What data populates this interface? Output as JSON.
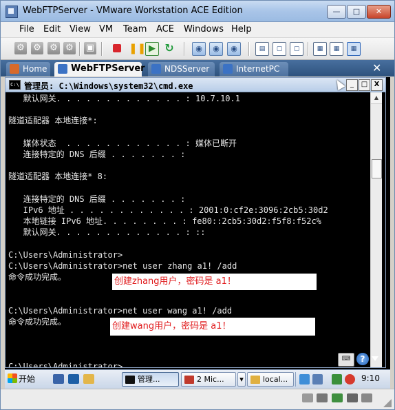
{
  "window": {
    "title": "WebFTPServer - VMware Workstation ACE Edition",
    "min_glyph": "—",
    "max_glyph": "□",
    "close_glyph": "✕"
  },
  "menu": [
    "File",
    "Edit",
    "View",
    "VM",
    "Team",
    "ACE",
    "Windows",
    "Help"
  ],
  "tabs": [
    {
      "label": "Home",
      "active": false,
      "icon_color": "#d86a2b"
    },
    {
      "label": "WebFTPServer",
      "active": true,
      "icon_color": "#3b72c4"
    },
    {
      "label": "NDSServer",
      "active": false,
      "icon_color": "#3b72c4"
    },
    {
      "label": "InternetPC",
      "active": false,
      "icon_color": "#3b72c4"
    }
  ],
  "tabs_close_glyph": "✕",
  "cmd": {
    "icon_text": "C:\\",
    "title": "管理员: C:\\Windows\\system32\\cmd.exe",
    "min_glyph": "_",
    "max_glyph": "□",
    "close_glyph": "X",
    "lines": [
      "   默认网关. . . . . . . . . . . . . : 10.7.10.1",
      "",
      "隧道适配器 本地连接*:",
      "",
      "   媒体状态  . . . . . . . . . . . . : 媒体已断开",
      "   连接特定的 DNS 后缀 . . . . . . . :",
      "",
      "隧道适配器 本地连接* 8:",
      "",
      "   连接特定的 DNS 后缀 . . . . . . . :",
      "   IPv6 地址 . . . . . . . . . . . . : 2001:0:cf2e:3096:2cb5:30d2",
      "   本地链接 IPv6 地址. . . . . . . . : fe80::2cb5:30d2:f5f8:f52c%",
      "   默认网关. . . . . . . . . . . . . : ::",
      "",
      "C:\\Users\\Administrator>",
      "C:\\Users\\Administrator>net user zhang a1! /add",
      "命令成功完成。",
      "",
      "",
      "C:\\Users\\Administrator>net user wang a1! /add",
      "命令成功完成。",
      "",
      "",
      "",
      "C:\\Users\\Administrator>_"
    ]
  },
  "annotations": {
    "zhang": "创建zhang用户，密码是 a1！",
    "wang": "创建wang用户，密码是 a1！"
  },
  "guest_taskbar": {
    "start_label": "开始",
    "tasks": [
      {
        "label": "管理...",
        "active": true,
        "icon_color": "#111111"
      },
      {
        "label": "2 Mic...",
        "active": false,
        "icon_color": "#c0392b"
      },
      {
        "label": "local...",
        "active": false,
        "icon_color": "#e0b040"
      }
    ],
    "clock": "9:10",
    "dropdown_glyph": "▾"
  },
  "corner": {
    "kbd_glyph": "⌨",
    "help_glyph": "?"
  },
  "colors": {
    "annotation_text": "#e0191b",
    "console_bg": "#000000",
    "console_text": "#e6e6e6"
  }
}
